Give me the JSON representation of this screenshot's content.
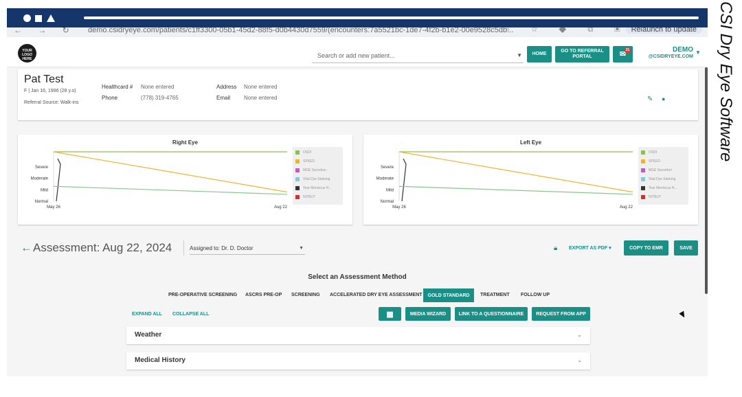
{
  "caption": "CSI Dry Eye Software",
  "browser": {
    "url": "demo.csidryeye.com/patients/c1ff3300-05b1-45d2-88f5-d0b4430d7559/(encounters:7a5521bc-1de7-4f2b-b1e2-00e9528c5db...",
    "relaunch_label": "Relaunch to update"
  },
  "header": {
    "logo_text": "YOUR LOGO HERE",
    "search_placeholder": "Search or add new patient...",
    "home_label": "HOME",
    "referral_label": "GO TO REFERRAL PORTAL",
    "mail_badge": "21",
    "user_name": "DEMO",
    "user_email": "@CSIDRYEYE.COM"
  },
  "patient": {
    "name": "Pat Test",
    "meta": "F | Jan 16, 1996 (28 y.o)",
    "referral": "Referral Source: Walk-ins",
    "healthcard_label": "Healthcard #",
    "healthcard_value": "None entered",
    "phone_label": "Phone",
    "phone_value": "(778) 319-4765",
    "address_label": "Address",
    "address_value": "None entered",
    "email_label": "Email",
    "email_value": "None entered"
  },
  "chart_data": [
    {
      "type": "line",
      "title": "Right Eye",
      "x": [
        "May 26",
        "Aug 22"
      ],
      "y_categories": [
        "Normal",
        "Mild",
        "Moderate",
        "Severe"
      ],
      "series": [
        {
          "name": "OSDI",
          "color": "#8bc34a",
          "values": [
            4.3,
            4.3
          ]
        },
        {
          "name": "SPEED",
          "color": "#f0b429",
          "values": [
            4.3,
            0.8
          ]
        },
        {
          "name": "MGE Secretion",
          "color": "#c45bc4",
          "values": [
            null,
            null
          ]
        },
        {
          "name": "Vital Dye Staining",
          "color": "#80cbe0",
          "values": [
            null,
            null
          ]
        },
        {
          "name": "Tear Meniscus H...",
          "color": "#333333",
          "values": [
            3.7,
            0.0
          ]
        },
        {
          "name": "NITBUT",
          "color": "#d32f2f",
          "values": [
            null,
            null
          ]
        },
        {
          "name": "",
          "color": "#8bc48e",
          "values": [
            1.3,
            0.6
          ]
        }
      ]
    },
    {
      "type": "line",
      "title": "Left Eye",
      "x": [
        "May 26",
        "Aug 22"
      ],
      "y_categories": [
        "Normal",
        "Mild",
        "Moderate",
        "Severe"
      ],
      "series": [
        {
          "name": "OSDI",
          "color": "#8bc34a",
          "values": [
            4.3,
            4.3
          ]
        },
        {
          "name": "SPEED",
          "color": "#f0b429",
          "values": [
            4.3,
            0.8
          ]
        },
        {
          "name": "MGE Secretion",
          "color": "#c45bc4",
          "values": [
            null,
            null
          ]
        },
        {
          "name": "Vital Dye Staining",
          "color": "#80cbe0",
          "values": [
            null,
            null
          ]
        },
        {
          "name": "Tear Meniscus H...",
          "color": "#333333",
          "values": [
            3.7,
            0.0
          ]
        },
        {
          "name": "NITBUT",
          "color": "#d32f2f",
          "values": [
            null,
            null
          ]
        },
        {
          "name": "",
          "color": "#8bc48e",
          "values": [
            1.3,
            0.6
          ]
        }
      ]
    }
  ],
  "assessment": {
    "title": "Assessment: Aug 22, 2024",
    "assigned": "Assigned to: Dr. D. Doctor",
    "export_label": "EXPORT AS PDF",
    "copy_label": "COPY TO EMR",
    "save_label": "SAVE",
    "method_title": "Select an Assessment Method",
    "tabs": [
      "PRE-OPERATIVE SCREENING",
      "ASCRS PRE-OP",
      "SCREENING",
      "ACCELERATED DRY EYE ASSESSMENT",
      "GOLD STANDARD",
      "TREATMENT",
      "FOLLOW UP"
    ],
    "active_tab": "GOLD STANDARD",
    "expand_all": "EXPAND ALL",
    "collapse_all": "COLLAPSE ALL",
    "media_wizard": "MEDIA WIZARD",
    "link_questionnaire": "LINK TO A QUESTIONNAIRE",
    "request_app": "REQUEST FROM APP",
    "sections": [
      "Weather",
      "Medical History"
    ]
  },
  "colors": {
    "accent": "#1a8f85",
    "titlebar": "#14366b"
  }
}
